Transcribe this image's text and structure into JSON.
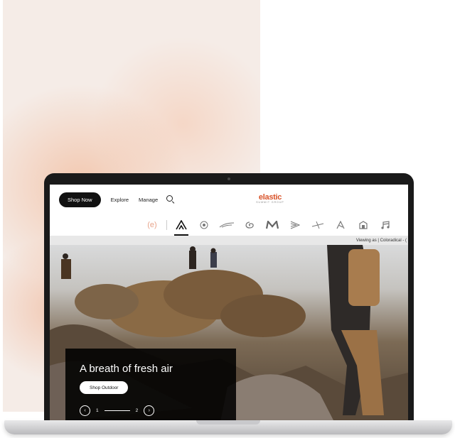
{
  "header": {
    "shop_now_label": "Shop Now",
    "explore_label": "Explore",
    "manage_label": "Manage",
    "logo_text": "elastic",
    "logo_subtext": "SUMMIT GROUP"
  },
  "brands": {
    "first_mark": "(e)",
    "icons": [
      "brand-a-icon",
      "brand-b-icon",
      "brand-c-icon",
      "brand-d-icon",
      "brand-m-icon",
      "brand-f-icon",
      "brand-g-icon",
      "brand-h-icon",
      "brand-i-icon",
      "brand-j-icon"
    ]
  },
  "viewing": {
    "text": "Viewing as | Coloradical - ("
  },
  "hero": {
    "title": "A breath of fresh air",
    "cta_label": "Shop Outdoor",
    "pager_prev": "‹",
    "pager_current": "1",
    "pager_total": "2",
    "pager_next": "›"
  },
  "colors": {
    "accent": "#d9542b",
    "panel": "#f5ece7"
  }
}
